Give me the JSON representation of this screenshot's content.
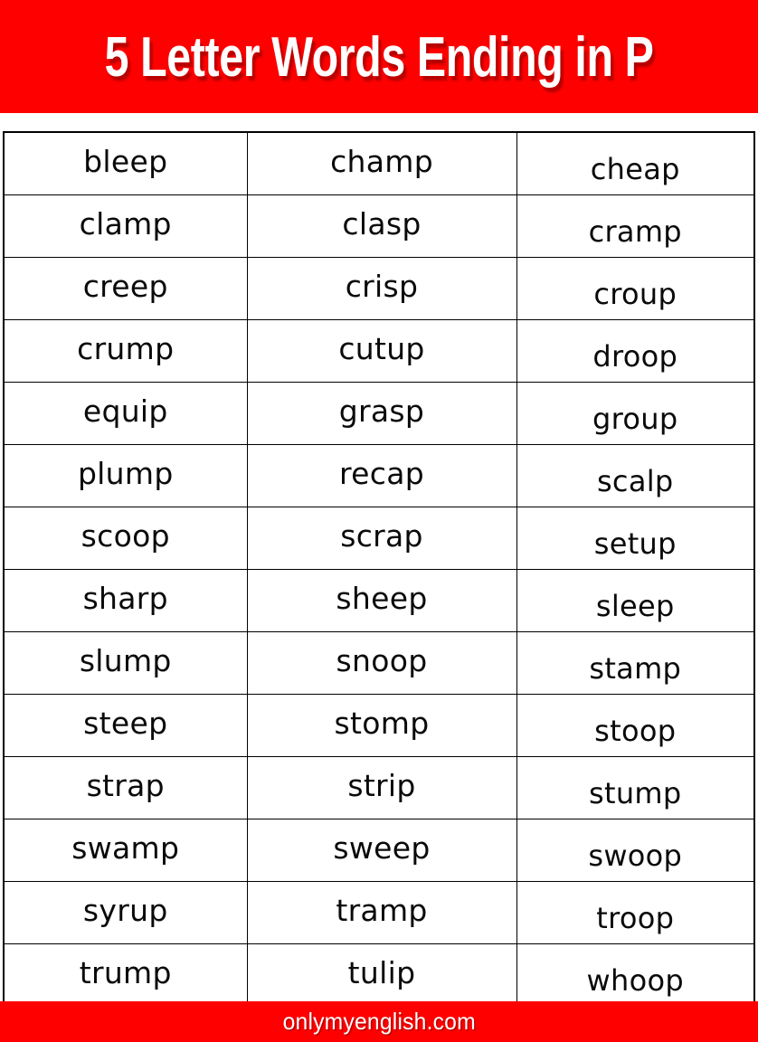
{
  "header": {
    "title": "5 Letter Words Ending in P",
    "background_color": "#ff0000",
    "text_color": "#ffffff"
  },
  "footer": {
    "site": "onlymyenglish.com",
    "background_color": "#ff0000",
    "text_color": "#ffffff"
  },
  "table": {
    "columns": 3,
    "rows": 14,
    "border_color": "#000000",
    "cells": [
      [
        "bleep",
        "champ",
        "cheap"
      ],
      [
        "clamp",
        "clasp",
        "cramp"
      ],
      [
        "creep",
        "crisp",
        "croup"
      ],
      [
        "crump",
        "cutup",
        "droop"
      ],
      [
        "equip",
        "grasp",
        "group"
      ],
      [
        "plump",
        "recap",
        "scalp"
      ],
      [
        "scoop",
        "scrap",
        "setup"
      ],
      [
        "sharp",
        "sheep",
        "sleep"
      ],
      [
        "slump",
        "snoop",
        "stamp"
      ],
      [
        "steep",
        "stomp",
        "stoop"
      ],
      [
        "strap",
        "strip",
        "stump"
      ],
      [
        "swamp",
        "sweep",
        "swoop"
      ],
      [
        "syrup",
        "tramp",
        "troop"
      ],
      [
        "trump",
        "tulip",
        "whoop"
      ]
    ]
  }
}
